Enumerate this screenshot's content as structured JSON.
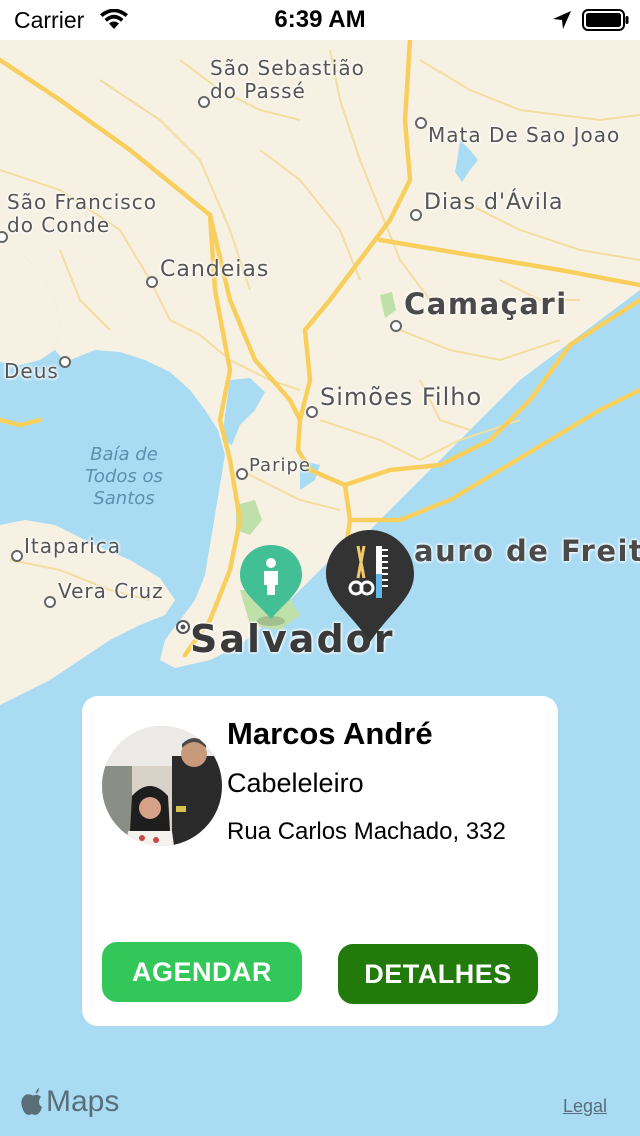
{
  "status_bar": {
    "carrier": "Carrier",
    "time": "6:39 AM"
  },
  "map": {
    "cities": [
      {
        "name": "São Sebastião\ndo Passé",
        "size": "normal"
      },
      {
        "name": "Mata De Sao Joao",
        "size": "normal"
      },
      {
        "name": "Dias d'Ávila",
        "size": "normal"
      },
      {
        "name": "São Francisco\ndo Conde",
        "size": "normal"
      },
      {
        "name": "Candeias",
        "size": "normal"
      },
      {
        "name": "Camaçari",
        "size": "big"
      },
      {
        "name": "Deus",
        "size": "normal"
      },
      {
        "name": "Simões Filho",
        "size": "normal"
      },
      {
        "name": "Paripe",
        "size": "normal"
      },
      {
        "name": "Itaparica",
        "size": "normal"
      },
      {
        "name": "Vera Cruz",
        "size": "normal"
      },
      {
        "name": "auro de Freit",
        "size": "big"
      },
      {
        "name": "Salvador",
        "size": "huge"
      }
    ],
    "water_labels": [
      "Baía de\nTodos os\nSantos"
    ],
    "colors": {
      "land": "#f7f1e3",
      "water": "#a9dcf3",
      "highway": "#f8cf5c",
      "road": "#f2dea0",
      "park": "#bfe0a8"
    },
    "pins": {
      "user_icon": "person-pin-icon",
      "user_color": "#43bf96",
      "barber_icon": "scissors-comb-pin-icon",
      "barber_color": "#333333"
    }
  },
  "card": {
    "name": "Marcos André",
    "role": "Cabeleleiro",
    "address": "Rua Carlos Machado, 332",
    "buttons": {
      "agendar": "AGENDAR",
      "detalhes": "DETALHES"
    },
    "colors": {
      "agendar": "#33c75a",
      "detalhes": "#217a0a"
    }
  },
  "footer": {
    "maps_label": "Maps",
    "legal_label": "Legal"
  }
}
